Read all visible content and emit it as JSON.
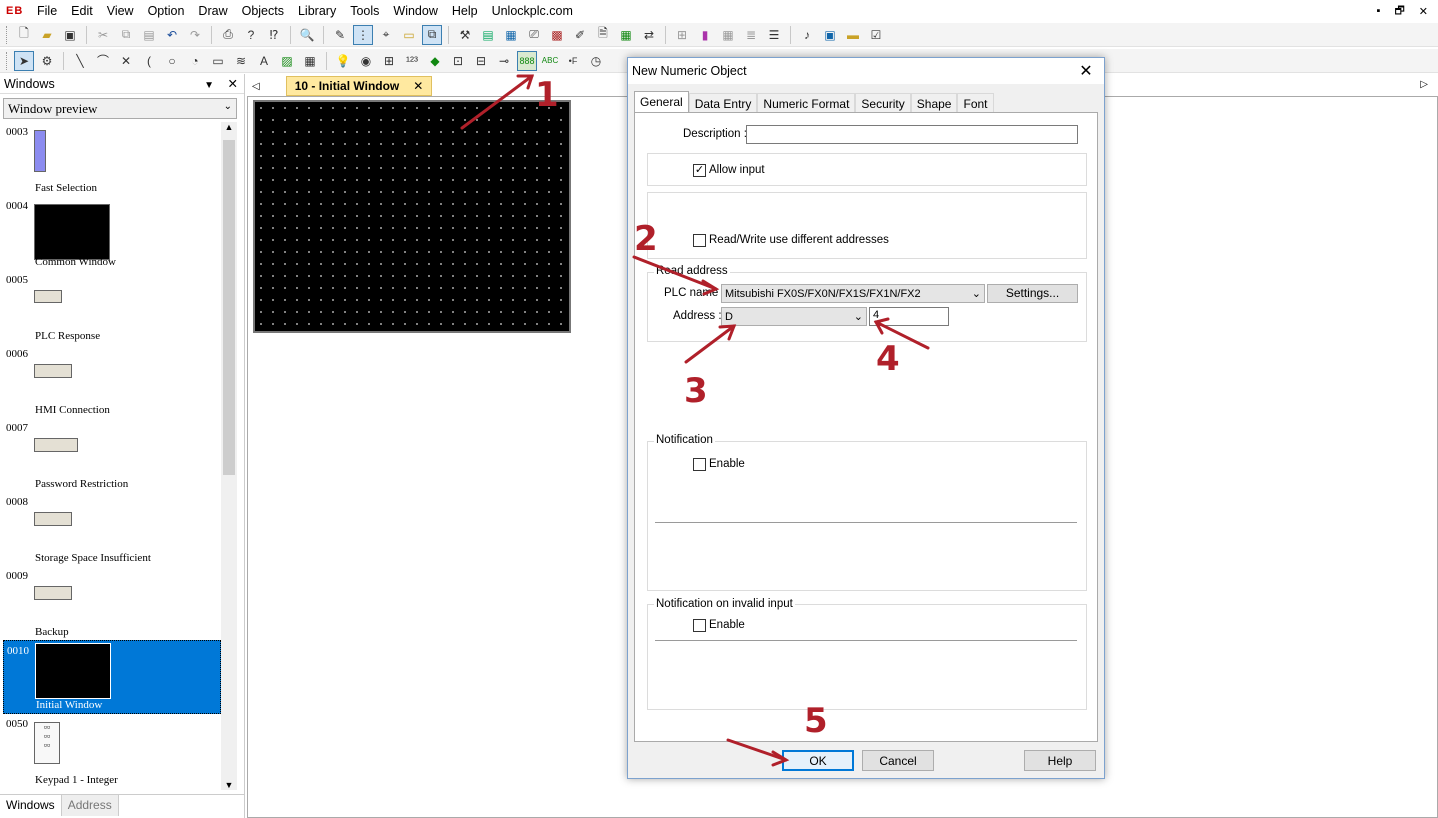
{
  "app": {
    "logo": "EB"
  },
  "menu": [
    "File",
    "Edit",
    "View",
    "Option",
    "Draw",
    "Objects",
    "Library",
    "Tools",
    "Window",
    "Help",
    "Unlockplc.com"
  ],
  "window_controls": {
    "minimize": "▪",
    "restore": "🗗",
    "close": "✕"
  },
  "left_panel": {
    "title": "Windows",
    "select_value": "Window preview",
    "items": [
      {
        "num": "0003",
        "caption": "Fast Selection"
      },
      {
        "num": "0004",
        "caption": "Common Window"
      },
      {
        "num": "0005",
        "caption": "PLC Response"
      },
      {
        "num": "0006",
        "caption": "HMI Connection"
      },
      {
        "num": "0007",
        "caption": "Password Restriction"
      },
      {
        "num": "0008",
        "caption": "Storage Space Insufficient"
      },
      {
        "num": "0009",
        "caption": "Backup"
      },
      {
        "num": "0010",
        "caption": "Initial Window"
      },
      {
        "num": "0050",
        "caption": "Keypad 1 - Integer"
      }
    ],
    "tabs": [
      "Windows",
      "Address"
    ]
  },
  "doc_tab": {
    "label": "10 - Initial Window",
    "close": "✕"
  },
  "dialog": {
    "title": "New Numeric Object",
    "close": "✕",
    "tabs": [
      "General",
      "Data Entry",
      "Numeric Format",
      "Security",
      "Shape",
      "Font"
    ],
    "description_label": "Description :",
    "description_value": "",
    "allow_input_label": "Allow input",
    "allow_input_mark": "✓",
    "rw_diff_label": "Read/Write use different addresses",
    "read_address_label": "Read address",
    "plc_name_label": "PLC name :",
    "plc_name_value": "Mitsubishi FX0S/FX0N/FX1S/FX1N/FX2",
    "settings_button": "Settings...",
    "address_label": "Address :",
    "address_device": "D",
    "address_value": "4",
    "notification_label": "Notification",
    "notification_enable": "Enable",
    "notification_invalid_label": "Notification on invalid input",
    "invalid_enable": "Enable",
    "ok_button": "OK",
    "cancel_button": "Cancel",
    "help_button": "Help"
  },
  "annotations": [
    "1",
    "2",
    "3",
    "4",
    "5"
  ],
  "colors": {
    "annotation": "#b0202a",
    "selection": "#0078d7",
    "tab_highlight": "#ffe9a0"
  }
}
